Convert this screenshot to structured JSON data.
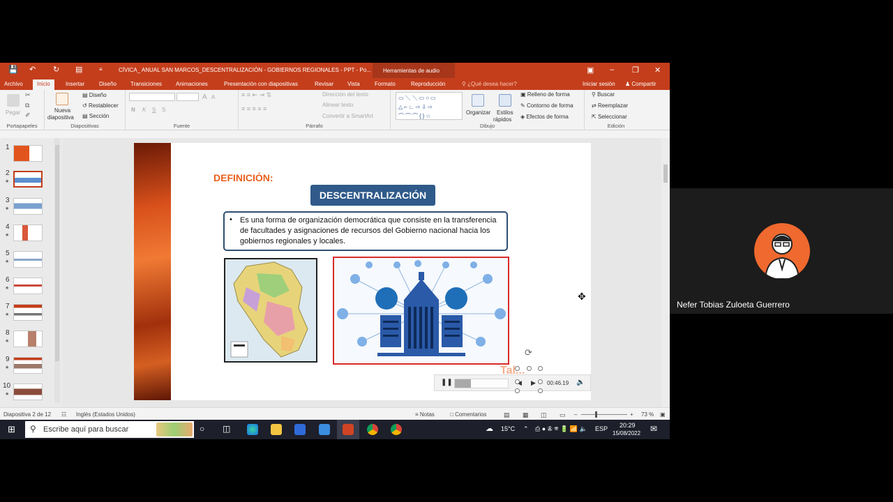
{
  "titlebar": {
    "document_title": "CÍVICA_ ANUAL SAN MARCOS_DESCENTRALIZACIÓN - GOBIERNOS REGIONALES - PPT - Po...",
    "tools_tab": "Herramientas de audio"
  },
  "tabs": [
    "Archivo",
    "Inicio",
    "Insertar",
    "Diseño",
    "Transiciones",
    "Animaciones",
    "Presentación con diapositivas",
    "Revisar",
    "Vista",
    "Formato",
    "Reproducción"
  ],
  "active_tab": "Inicio",
  "tell_me": "¿Qué desea hacer?",
  "sign_in": "Iniciar sesión",
  "share": "Compartir",
  "ribbon": {
    "clipboard": {
      "paste": "Pegar",
      "label": "Portapapeles"
    },
    "slides": {
      "new_slide_1": "Nueva",
      "new_slide_2": "diapositiva",
      "layout": "Diseño",
      "reset": "Restablecer",
      "section": "Sección",
      "label": "Diapositivas"
    },
    "font": {
      "label": "Fuente",
      "bold": "N",
      "italic": "K",
      "underline": "S",
      "strike": "S",
      "size_inc": "A",
      "size_dec": "A"
    },
    "paragraph": {
      "text_direction": "Dirección del texto",
      "align_text": "Alinear texto",
      "smartart": "Convertir a SmartArt",
      "label": "Párrafo"
    },
    "drawing": {
      "arrange": "Organizar",
      "quick_styles_1": "Estilos",
      "quick_styles_2": "rápidos",
      "fill": "Relleno de forma",
      "outline": "Contorno de forma",
      "effects": "Efectos de forma",
      "label": "Dibujo"
    },
    "editing": {
      "find": "Buscar",
      "replace": "Reemplazar",
      "select": "Seleccionar",
      "label": "Edición"
    }
  },
  "thumbnails": [
    "1",
    "2",
    "3",
    "4",
    "5",
    "6",
    "7",
    "8",
    "9",
    "10"
  ],
  "selected_slide": 2,
  "slide": {
    "heading": "DEFINICIÓN:",
    "chip": "DESCENTRALIZACIÓN",
    "bullet": "•",
    "definition": "Es una forma de organización democrática que consiste en la transferencia de facultades y asignaciones de recursos del Gobierno nacional hacia los gobiernos regionales y locales.",
    "partial_text": "Tal..."
  },
  "media": {
    "time": "00:46.19",
    "progress": 0.3
  },
  "statusbar": {
    "slide_info": "Diapositiva 2 de 12",
    "language": "Inglés (Estados Unidos)",
    "notes": "Notas",
    "comments": "Comentarios",
    "zoom": "73 %"
  },
  "taskbar": {
    "search_placeholder": "Escribe aquí para buscar",
    "temperature": "15°C",
    "lang": "ESP",
    "time": "20:29",
    "date": "15/08/2022"
  },
  "participant": {
    "name": "Nefer Tobias Zuloeta Guerrero"
  },
  "colors": {
    "accent": "#c43e1c",
    "chip": "#2f5a8a",
    "heading": "#e8601e"
  }
}
